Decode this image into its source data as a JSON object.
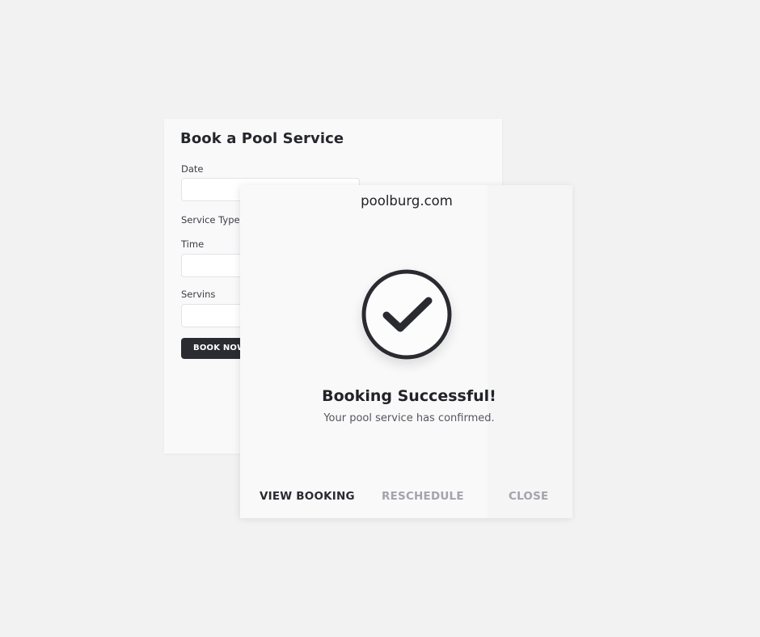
{
  "booking_form": {
    "title": "Book a Pool Service",
    "fields": [
      {
        "label": "Date",
        "value": ""
      },
      {
        "label": "Service Type",
        "value": ""
      },
      {
        "label": "Time",
        "value": ""
      },
      {
        "label": "Servins",
        "value": ""
      }
    ],
    "book_button_label": "BOOK NOW"
  },
  "success_modal": {
    "domain": "poolburg.com",
    "icon": "checkmark-circle-icon",
    "title": "Booking Successful!",
    "message": "Your pool service has confirmed.",
    "actions": {
      "view_booking": "VIEW BOOKING",
      "reschedule": "RESCHEDULE",
      "close": "CLOSE"
    }
  },
  "colors": {
    "background": "#f2f2f3",
    "card": "#f9f9fa",
    "primary_dark": "#2b2c31",
    "muted_action": "#a3a5ab"
  }
}
